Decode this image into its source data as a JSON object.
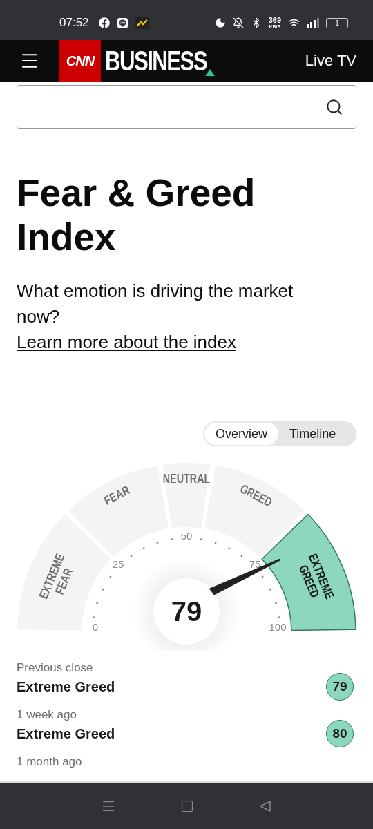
{
  "status_bar": {
    "time": "07:52",
    "net_speed": "369",
    "net_unit": "KB/S",
    "battery": "1"
  },
  "header": {
    "logo_mark": "CNN",
    "logo_name": "BUSINESS",
    "live": "Live TV"
  },
  "title": "Fear & Greed Index",
  "subtitle": "What emotion is driving the market now?",
  "link": "Learn more about the index",
  "view_tabs": [
    {
      "label": "Overview",
      "selected": true
    },
    {
      "label": "Timeline",
      "selected": false
    }
  ],
  "gauge": {
    "score": "79",
    "segments": [
      {
        "lines": [
          "EXTREME",
          "FEAR"
        ],
        "selected": false
      },
      {
        "lines": [
          "FEAR"
        ],
        "selected": false
      },
      {
        "lines": [
          "NEUTRAL"
        ],
        "selected": false
      },
      {
        "lines": [
          "GREED"
        ],
        "selected": false
      },
      {
        "lines": [
          "EXTREME",
          "GREED"
        ],
        "selected": true
      }
    ],
    "ticks": [
      "0",
      "25",
      "50",
      "75",
      "100"
    ]
  },
  "history": [
    {
      "label": "Previous close",
      "rating": "Extreme Greed",
      "value": "79"
    },
    {
      "label": "1 week ago",
      "rating": "Extreme Greed",
      "value": "80"
    },
    {
      "label": "1 month ago"
    }
  ]
}
